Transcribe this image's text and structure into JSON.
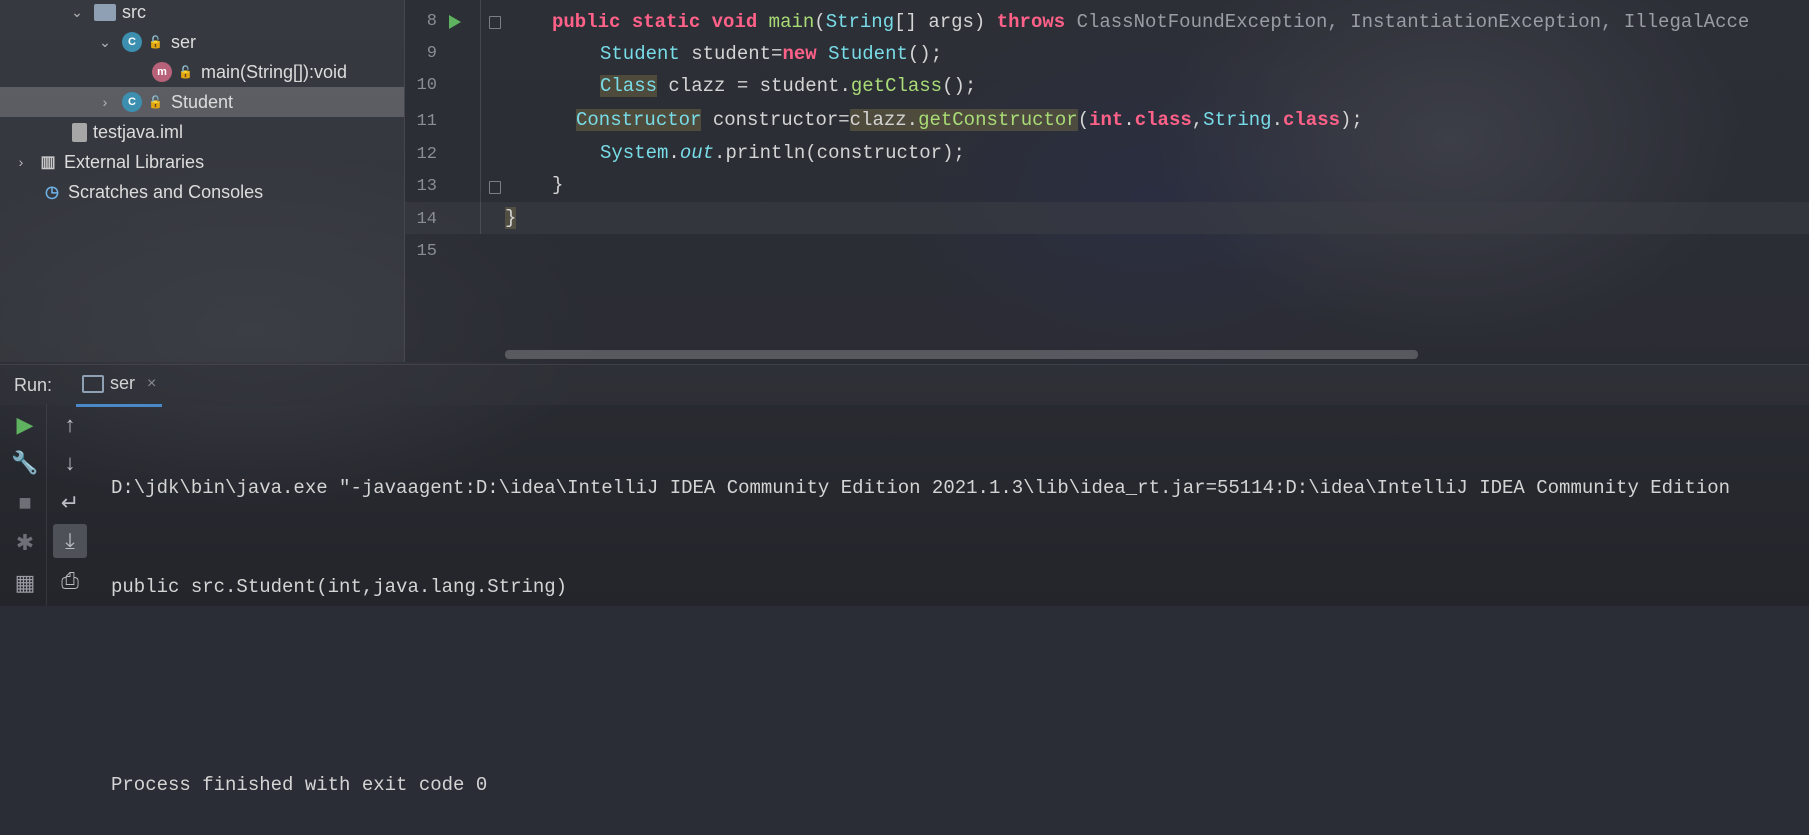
{
  "project_tree": {
    "items": [
      {
        "label": "src"
      },
      {
        "label": "ser"
      },
      {
        "label": "main(String[]):void"
      },
      {
        "label": "Student"
      },
      {
        "label": "testjava.iml"
      },
      {
        "label": "External Libraries"
      },
      {
        "label": "Scratches and Consoles"
      }
    ]
  },
  "editor": {
    "line_numbers": [
      "8",
      "9",
      "10",
      "11",
      "12",
      "13",
      "14",
      "15"
    ],
    "code": {
      "l8_public": "public",
      "l8_static": "static",
      "l8_void": "void",
      "l8_main": "main",
      "l8_string": "String",
      "l8_args": "[] args)",
      "l8_throws": "throws",
      "l8_exceptions": "ClassNotFoundException, InstantiationException, IllegalAcce",
      "l9_type": "Student",
      "l9_var": " student=",
      "l9_new": "new",
      "l9_ctor": "Student",
      "l9_end": "();",
      "l10_type": "Class",
      "l10_var": " clazz = student.",
      "l10_call": "getClass",
      "l10_end": "();",
      "l11_type": "Constructor",
      "l11_var": " constructor=",
      "l11_clazz": "clazz.",
      "l11_call": "getConstructor",
      "l11_open": "(",
      "l11_int": "int",
      "l11_dot1": ".",
      "l11_class1": "class",
      "l11_comma": ",",
      "l11_string": "String",
      "l11_dot2": ".",
      "l11_class2": "class",
      "l11_end": ");",
      "l12_system": "System",
      "l12_dot": ".",
      "l12_out": "out",
      "l12_rest": ".println(constructor);",
      "l13": "}",
      "l14": "}"
    }
  },
  "run_panel": {
    "label": "Run:",
    "tab": "ser",
    "tab_close": "×",
    "console_lines": [
      "D:\\jdk\\bin\\java.exe \"-javaagent:D:\\idea\\IntelliJ IDEA Community Edition 2021.1.3\\lib\\idea_rt.jar=55114:D:\\idea\\IntelliJ IDEA Community Edition",
      "public src.Student(int,java.lang.String)",
      "",
      "Process finished with exit code 0"
    ]
  },
  "icons": [
    "chevron-down-icon",
    "chevron-right-icon",
    "folder-icon",
    "class-icon",
    "method-icon",
    "lock-icon",
    "file-icon",
    "library-icon",
    "scratch-icon",
    "run-icon",
    "wrench-icon",
    "stop-icon",
    "arrow-up-icon",
    "arrow-down-icon",
    "soft-wrap-icon",
    "scroll-end-icon",
    "print-icon"
  ]
}
